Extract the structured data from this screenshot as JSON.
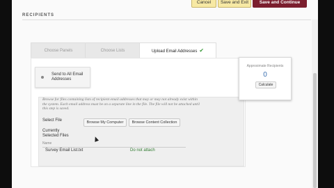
{
  "topbar": {
    "cancel_label": "Cancel",
    "save_exit_label": "Save and Exit",
    "save_continue_label": "Save and Continue"
  },
  "section": {
    "title": "RECIPIENTS"
  },
  "tabs": [
    {
      "label": "Choose Panels",
      "active": false
    },
    {
      "label": "Choose Lists",
      "active": false
    },
    {
      "label": "Upload Email Addresses",
      "active": true
    }
  ],
  "radio": {
    "label": "Send to All Email Addresses"
  },
  "upload": {
    "description": "Browse for files containing lists of recipient email addresses that may or may not already exist within the system. Each email address must be on a separate line in the file. The file will not be attached until this step is saved.",
    "select_file_label": "Select File",
    "browse_computer_label": "Browse My Computer",
    "browse_content_label": "Browse Content Collection",
    "currently_selected_label": "Currently Selected Files",
    "table_header_name": "Name",
    "file_name": "Survey Email List.txt",
    "do_not_attach_label": "Do not attach"
  },
  "popover": {
    "title": "Approximate Recipients",
    "count": "0",
    "calculate_label": "Calculate"
  },
  "colors": {
    "primary_button": "#7b1e2e",
    "secondary_button": "#f7e9a4",
    "link": "#2f7a2f",
    "count": "#3a6fb0"
  }
}
